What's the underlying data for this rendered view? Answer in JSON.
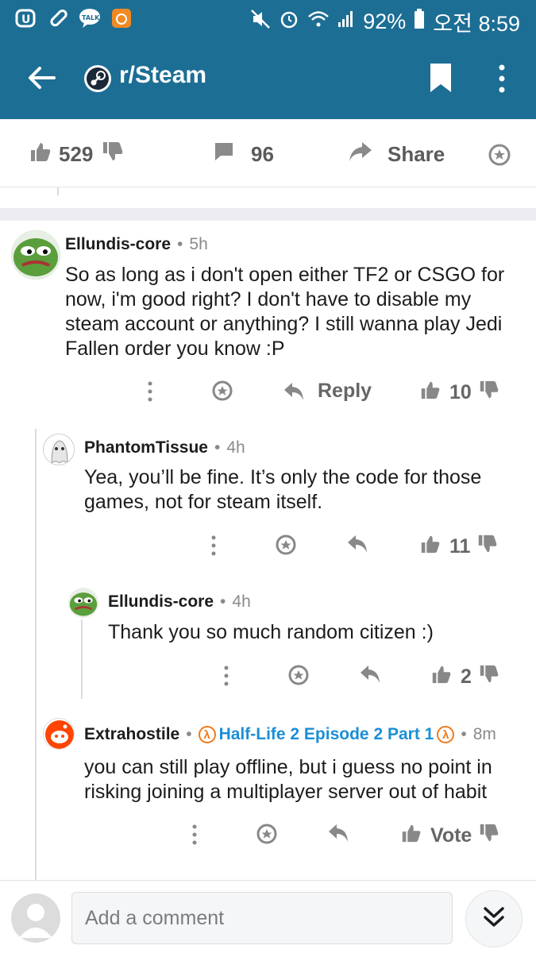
{
  "status_bar": {
    "battery": "92%",
    "time": "오전 8:59"
  },
  "app_bar": {
    "title": "r/Steam"
  },
  "post_actions": {
    "upvotes": "529",
    "comments": "96",
    "share_label": "Share"
  },
  "comments": [
    {
      "user": "Ellundis-core",
      "time": "5h",
      "text": [
        "So as long as i don't open either TF2 or CSGO for",
        "now, i'm good right? I don't have to disable my",
        "steam account or anything? I still wanna play Jedi",
        "Fallen order you know :P"
      ],
      "reply_label": "Reply",
      "score": "10"
    },
    {
      "user": "PhantomTissue",
      "time": "4h",
      "text": [
        "Yea, you’ll be fine. It’s only the code for those",
        "games, not for steam itself."
      ],
      "score": "11"
    },
    {
      "user": "Ellundis-core",
      "time": "4h",
      "text": [
        "Thank you so much random citizen :)"
      ],
      "score": "2"
    },
    {
      "user": "Extrahostile",
      "flair": "Half-Life 2 Episode 2 Part 1",
      "time": "8m",
      "text": [
        "you can still play offline, but  i guess no point in",
        "risking joining a multiplayer server out of habit"
      ],
      "score": "Vote"
    }
  ],
  "composer": {
    "placeholder": "Add a comment"
  },
  "colors": {
    "header": "#1d6e94",
    "flair": "#1b8fd6",
    "flair_badge": "#f07a1a"
  }
}
